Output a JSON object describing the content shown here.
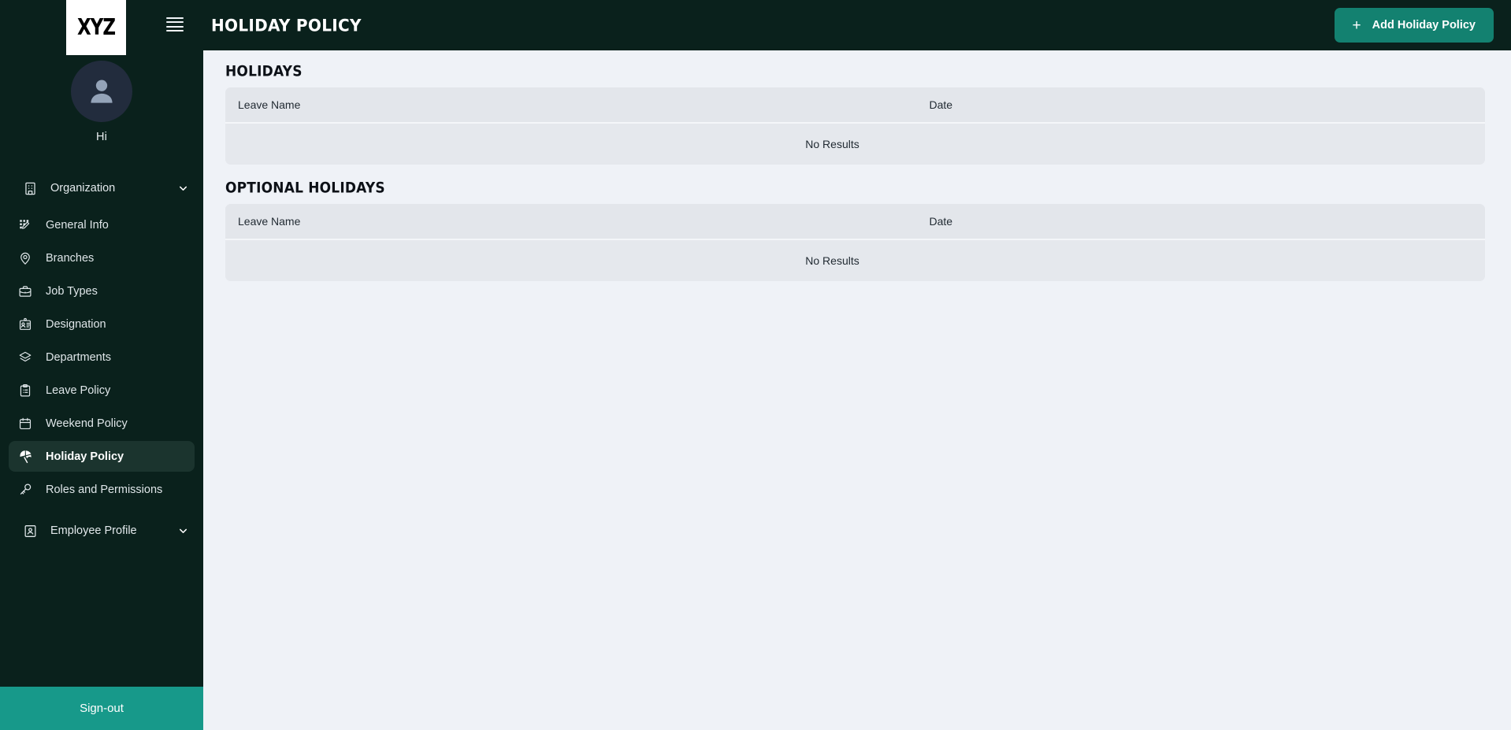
{
  "brand": {
    "logo_text": "XYZ"
  },
  "sidebar": {
    "menu_icon": "hamburger-icon",
    "avatar_icon": "user-avatar-icon",
    "greeting": "Hi",
    "groups": [
      {
        "label": "Organization",
        "icon": "building-icon",
        "chevron": "chevron-down-icon",
        "items": [
          {
            "label": "General Info",
            "icon": "grid-edit-icon",
            "active": false
          },
          {
            "label": "Branches",
            "icon": "location-pin-icon",
            "active": false
          },
          {
            "label": "Job Types",
            "icon": "briefcase-icon",
            "active": false
          },
          {
            "label": "Designation",
            "icon": "id-badge-icon",
            "active": false
          },
          {
            "label": "Departments",
            "icon": "layers-icon",
            "active": false
          },
          {
            "label": "Leave Policy",
            "icon": "clipboard-list-icon",
            "active": false
          },
          {
            "label": "Weekend Policy",
            "icon": "calendar-icon",
            "active": false
          },
          {
            "label": "Holiday Policy",
            "icon": "beach-umbrella-icon",
            "active": true
          },
          {
            "label": "Roles and Permissions",
            "icon": "key-icon",
            "active": false
          }
        ]
      },
      {
        "label": "Employee Profile",
        "icon": "profile-card-icon",
        "chevron": "chevron-down-icon",
        "items": []
      }
    ],
    "signout_label": "Sign-out"
  },
  "topbar": {
    "title": "HOLIDAY POLICY",
    "add_button": {
      "label": "Add Holiday Policy",
      "icon": "plus-icon",
      "plus": "+"
    }
  },
  "main": {
    "sections": [
      {
        "title": "HOLIDAYS",
        "columns": {
          "name": "Leave Name",
          "date": "Date"
        },
        "rows": [],
        "empty_text": "No Results"
      },
      {
        "title": "OPTIONAL HOLIDAYS",
        "columns": {
          "name": "Leave Name",
          "date": "Date"
        },
        "rows": [],
        "empty_text": "No Results"
      }
    ]
  },
  "colors": {
    "sidebar_bg": "#0a211c",
    "accent": "#17998a",
    "button": "#138170",
    "active_item": "#1b342e",
    "content_bg": "#eff2f7",
    "table_bg": "#e5e8ed"
  }
}
